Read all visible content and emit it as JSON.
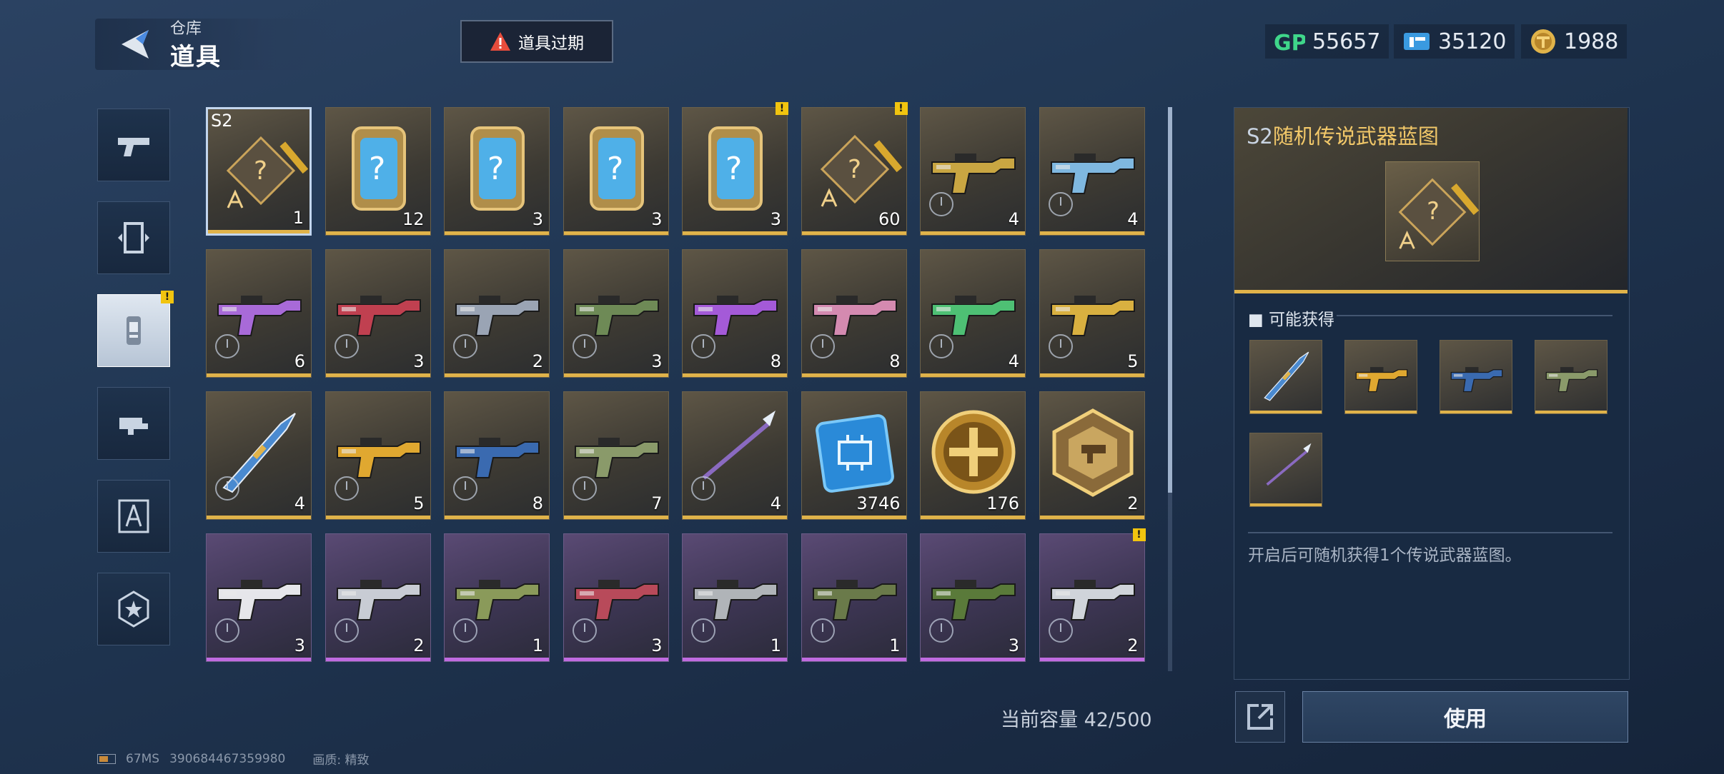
{
  "header": {
    "section": "仓库",
    "title": "道具",
    "expire_button": "道具过期"
  },
  "currencies": [
    {
      "icon": "gp-icon",
      "label": "GP",
      "value": "55657"
    },
    {
      "icon": "ticket-icon",
      "value": "35120"
    },
    {
      "icon": "gold-coin-icon",
      "value": "1988"
    }
  ],
  "side_tabs": [
    {
      "name": "weapons",
      "icon": "pistol-icon"
    },
    {
      "name": "skins",
      "icon": "card-icon"
    },
    {
      "name": "items",
      "icon": "can-icon",
      "active": true
    },
    {
      "name": "parts",
      "icon": "attachment-icon"
    },
    {
      "name": "blueprints",
      "icon": "compass-icon"
    },
    {
      "name": "badges",
      "icon": "star-badge-icon"
    }
  ],
  "grid": {
    "rows": [
      [
        {
          "kind": "blueprint",
          "count": "1",
          "tag": "S2",
          "selected": true
        },
        {
          "kind": "card",
          "count": "12"
        },
        {
          "kind": "card",
          "count": "3"
        },
        {
          "kind": "card",
          "count": "3"
        },
        {
          "kind": "card",
          "count": "3",
          "flag": true
        },
        {
          "kind": "blueprint",
          "count": "60",
          "flag": true
        },
        {
          "kind": "gun",
          "count": "4",
          "color": "#c9a642"
        },
        {
          "kind": "gun",
          "count": "4",
          "color": "#7fb8e0"
        }
      ],
      [
        {
          "kind": "gun",
          "count": "6",
          "color": "#a86ad8"
        },
        {
          "kind": "gun",
          "count": "3",
          "color": "#c04050"
        },
        {
          "kind": "gun",
          "count": "2",
          "color": "#9aa4b4"
        },
        {
          "kind": "gun",
          "count": "3",
          "color": "#6e8a56"
        },
        {
          "kind": "gun",
          "count": "8",
          "color": "#a45ad8"
        },
        {
          "kind": "gun",
          "count": "8",
          "color": "#d48ab0"
        },
        {
          "kind": "gun",
          "count": "4",
          "color": "#4ec074"
        },
        {
          "kind": "gun",
          "count": "5",
          "color": "#d9b040"
        }
      ],
      [
        {
          "kind": "knife",
          "count": "4",
          "color": "#4a8ad0"
        },
        {
          "kind": "gun",
          "count": "5",
          "color": "#e0a830"
        },
        {
          "kind": "gun",
          "count": "8",
          "color": "#3a6ab0"
        },
        {
          "kind": "gun",
          "count": "7",
          "color": "#8a9a6a"
        },
        {
          "kind": "spear",
          "count": "4",
          "color": "#8a6ac0"
        },
        {
          "kind": "chip",
          "count": "3746"
        },
        {
          "kind": "coin",
          "count": "176"
        },
        {
          "kind": "emblem",
          "count": "2"
        }
      ],
      [
        {
          "kind": "gun",
          "count": "3",
          "color": "#e6e6ea",
          "purple": true
        },
        {
          "kind": "gun",
          "count": "2",
          "color": "#c8ccd4",
          "purple": true
        },
        {
          "kind": "gun",
          "count": "1",
          "color": "#8a9a5a",
          "purple": true
        },
        {
          "kind": "gun",
          "count": "3",
          "color": "#b84a5a",
          "purple": true
        },
        {
          "kind": "gun",
          "count": "1",
          "color": "#b0b4b8",
          "purple": true
        },
        {
          "kind": "gun",
          "count": "1",
          "color": "#6a7a4a",
          "purple": true
        },
        {
          "kind": "gun",
          "count": "3",
          "color": "#5a7a3a",
          "purple": true
        },
        {
          "kind": "gun",
          "count": "2",
          "color": "#d0d4da",
          "purple": true,
          "flag": true
        }
      ]
    ]
  },
  "capacity": "当前容量 42/500",
  "detail": {
    "title_prefix": "S2",
    "title": "随机传说武器蓝图",
    "section": "可能获得",
    "rewards": [
      {
        "kind": "knife",
        "color": "#4a8ad0"
      },
      {
        "kind": "gun",
        "color": "#e0a830"
      },
      {
        "kind": "gun",
        "color": "#3a6ab0"
      },
      {
        "kind": "gun",
        "color": "#8a9a6a"
      },
      {
        "kind": "spear",
        "color": "#8a6ac0"
      }
    ],
    "description": "开启后可随机获得1个传说武器蓝图。",
    "use_button": "使用"
  },
  "footer": {
    "ping": "67MS",
    "uid": "390684467359980",
    "quality": "画质: 精致"
  },
  "colors": {
    "gold": "#e0b34a",
    "purple": "#c06be0",
    "flag": "#f1c40f"
  }
}
